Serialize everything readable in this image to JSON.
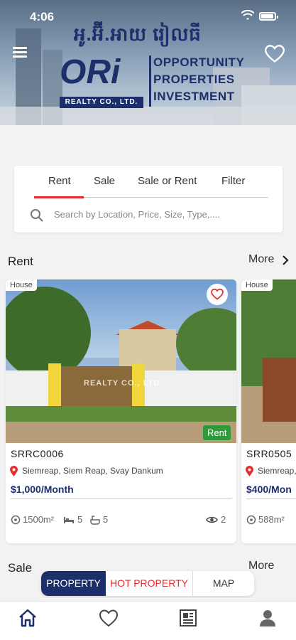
{
  "status_bar": {
    "time": "4:06"
  },
  "header": {
    "khmer_title": "អូ.អ៊ី.អាយ រៀលធី",
    "logo_letters": "ORi",
    "logo_subtitle": "REALTY CO., LTD.",
    "tagline_lines": [
      "OPPORTUNITY",
      "PROPERTIES",
      "INVESTMENT"
    ]
  },
  "search": {
    "tabs": [
      {
        "label": "Rent",
        "active": true
      },
      {
        "label": "Sale",
        "active": false
      },
      {
        "label": "Sale or Rent",
        "active": false
      },
      {
        "label": "Filter",
        "active": false
      }
    ],
    "placeholder": "Search by Location, Price, Size, Type,...."
  },
  "rent_section": {
    "title": "Rent",
    "more_label": "More",
    "cards": [
      {
        "type_badge": "House",
        "status_badge": "Rent",
        "watermark": "REALTY CO., LTD.",
        "code": "SRRC0006",
        "location": "Siemreap, Siem Reap, Svay Dankum",
        "price": "$1,000/Month",
        "area": "1500m²",
        "beds": "5",
        "baths": "5",
        "views": "2"
      },
      {
        "type_badge": "House",
        "code": "SRR0505",
        "location": "Siemreap,",
        "price": "$400/Mon",
        "area": "588m²"
      }
    ]
  },
  "sale_section": {
    "title": "Sale",
    "more_label": "More"
  },
  "segment": {
    "options": [
      "PROPERTY",
      "HOT PROPERTY",
      "MAP"
    ],
    "selected": "PROPERTY"
  },
  "colors": {
    "brand_navy": "#1c2f6b",
    "accent_red": "#e52d2d",
    "rent_green": "#2e9a3a"
  },
  "icons": [
    "menu-icon",
    "heart-icon",
    "search-icon",
    "location-pin-icon",
    "area-icon",
    "bed-icon",
    "bath-icon",
    "eye-icon",
    "chevron-right-icon",
    "home-icon",
    "favorites-icon",
    "news-icon",
    "profile-icon"
  ]
}
